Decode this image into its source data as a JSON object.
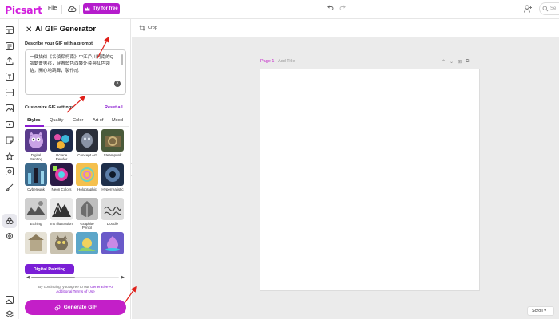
{
  "app": {
    "logo": "Picsart"
  },
  "topbar": {
    "file_label": "File",
    "try_label": "Try for free",
    "search_placeholder": "Se"
  },
  "panel": {
    "title": "AI GIF Generator",
    "describe_label": "Describe your GIF with a prompt",
    "prompt_value": "一個描似《名偵探柯南》中江戶川柯南的Q版動畫男孩，穿著藍色西裝外套與紅色領結，開心地跳舞，製作成",
    "customize_label": "Customize GIF settings",
    "reset_label": "Reset all",
    "tabs": [
      "Styles",
      "Quality",
      "Color",
      "Art of",
      "Mood"
    ],
    "styles": [
      {
        "label": "Digital Painting"
      },
      {
        "label": "Octane Render"
      },
      {
        "label": "Concept Art"
      },
      {
        "label": "Steampunk"
      },
      {
        "label": "Cyberpunk"
      },
      {
        "label": "Neon Colors"
      },
      {
        "label": "Holographic"
      },
      {
        "label": "Hyperrealistic"
      },
      {
        "label": "Etching"
      },
      {
        "label": "Ink Illustration"
      },
      {
        "label": "Graphite Pencil"
      },
      {
        "label": "Doodle"
      },
      {
        "label": ""
      },
      {
        "label": ""
      },
      {
        "label": ""
      },
      {
        "label": ""
      }
    ],
    "selected_style": "Digital Painting",
    "terms_prefix": "By continuing, you agree to our",
    "terms_link_1": "Generative AI",
    "terms_link_2": "Additional Terms of Use",
    "generate_label": "Generate GIF"
  },
  "canvas": {
    "crop_label": "Crop",
    "page_number": "Page 1",
    "page_title_placeholder": "- Add Title",
    "scroll_label": "Scroll"
  },
  "colors": {
    "brand": "#d21fdd",
    "accent": "#8a1bd1",
    "generate": "#c31fc8",
    "chip": "#7a1fd6",
    "annotation_arrow": "#e0201a"
  }
}
